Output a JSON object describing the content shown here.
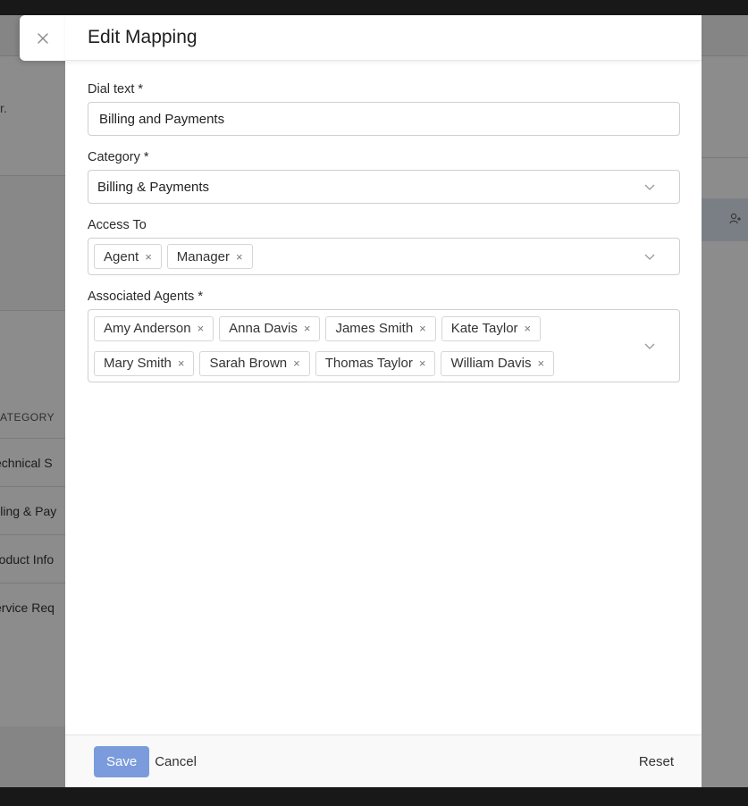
{
  "background": {
    "text_fragment": "r.",
    "column_header": "ATEGORY",
    "rows": [
      "echnical S",
      "illing & Pay",
      "roduct Info",
      "ervice Req"
    ],
    "right_icon": "add-user-icon"
  },
  "modal": {
    "close_icon": "close-icon",
    "title": "Edit Mapping",
    "fields": {
      "dial_text": {
        "label": "Dial text *",
        "value": "Billing and Payments"
      },
      "category": {
        "label": "Category *",
        "value": "Billing & Payments"
      },
      "access_to": {
        "label": "Access To",
        "tags": [
          "Agent",
          "Manager"
        ]
      },
      "associated_agents": {
        "label": "Associated Agents *",
        "tags": [
          "Amy Anderson",
          "Anna Davis",
          "James Smith",
          "Kate Taylor",
          "Mary Smith",
          "Sarah Brown",
          "Thomas Taylor",
          "William Davis"
        ]
      }
    },
    "footer": {
      "save_label": "Save",
      "cancel_label": "Cancel",
      "reset_label": "Reset"
    }
  },
  "colors": {
    "primary": "#7b9bdc",
    "overlay": "#2c2c2c"
  }
}
